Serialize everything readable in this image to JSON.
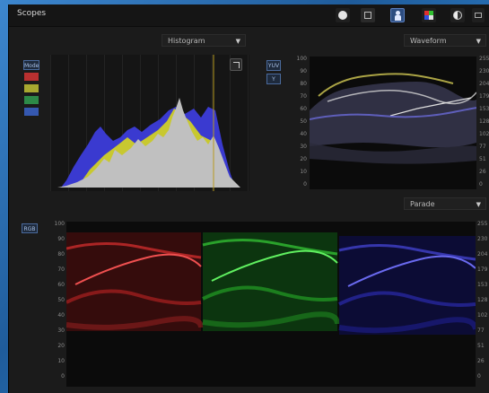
{
  "window": {
    "title": "Scopes"
  },
  "toolbar": {
    "icons": [
      "circle-icon",
      "checkbox-icon",
      "person-icon",
      "palette-icon",
      "contrast-icon",
      "more-icon"
    ]
  },
  "histogram": {
    "dropdown": "Histogram",
    "toggle": "Mode",
    "channels": [
      "#c83232",
      "#c8c832",
      "#32a050",
      "#3d5fc0"
    ]
  },
  "waveform": {
    "dropdown": "Waveform",
    "buttons": [
      "YUV",
      "Y"
    ]
  },
  "parade": {
    "dropdown": "Parade",
    "button": "RGB"
  },
  "scale_left": [
    "100",
    "90",
    "80",
    "70",
    "60",
    "50",
    "40",
    "30",
    "20",
    "10",
    "0"
  ],
  "scale_right": [
    "255",
    "230",
    "204",
    "179",
    "153",
    "128",
    "102",
    "77",
    "51",
    "26",
    "0"
  ],
  "colors": {
    "red": "#d03030",
    "green": "#30c030",
    "blue": "#3838d8",
    "yellow": "#d0d030"
  }
}
